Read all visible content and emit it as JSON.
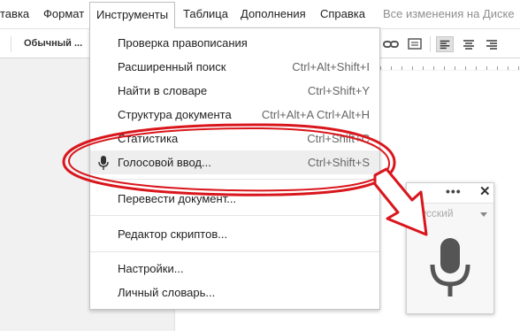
{
  "menubar": {
    "items": [
      {
        "label": "тавка"
      },
      {
        "label": "Формат"
      },
      {
        "label": "Инструменты"
      },
      {
        "label": "Таблица"
      },
      {
        "label": "Дополнения"
      },
      {
        "label": "Справка"
      }
    ],
    "saved_status": "Все изменения на Диске"
  },
  "toolbar": {
    "style_label": "Обычный ...",
    "icons": [
      "link-icon",
      "comment-icon",
      "align-left-icon",
      "align-center-icon",
      "align-right-icon"
    ]
  },
  "tools_menu": {
    "items": [
      {
        "label": "Проверка правописания",
        "shortcut": ""
      },
      {
        "label": "Расширенный поиск",
        "shortcut": "Ctrl+Alt+Shift+I"
      },
      {
        "label": "Найти в словаре",
        "shortcut": "Ctrl+Shift+Y"
      },
      {
        "label": "Структура документа",
        "shortcut": "Ctrl+Alt+A Ctrl+Alt+H"
      },
      {
        "label": "Статистика",
        "shortcut": "Ctrl+Shift+C"
      },
      {
        "label": "Голосовой ввод...",
        "shortcut": "Ctrl+Shift+S",
        "icon": "microphone-icon",
        "highlighted": true
      },
      {
        "label": "Перевести документ...",
        "shortcut": ""
      },
      {
        "label": "Редактор скриптов...",
        "shortcut": ""
      },
      {
        "label": "Настройки...",
        "shortcut": ""
      },
      {
        "label": "Личный словарь...",
        "shortcut": ""
      }
    ]
  },
  "voice_panel": {
    "menu_icon": "more-dots-icon",
    "close_icon": "close-icon",
    "dots": "•••",
    "close": "✕",
    "language": "Русский",
    "mic_icon": "microphone-icon"
  },
  "annotation": {
    "color": "#d9161c"
  }
}
